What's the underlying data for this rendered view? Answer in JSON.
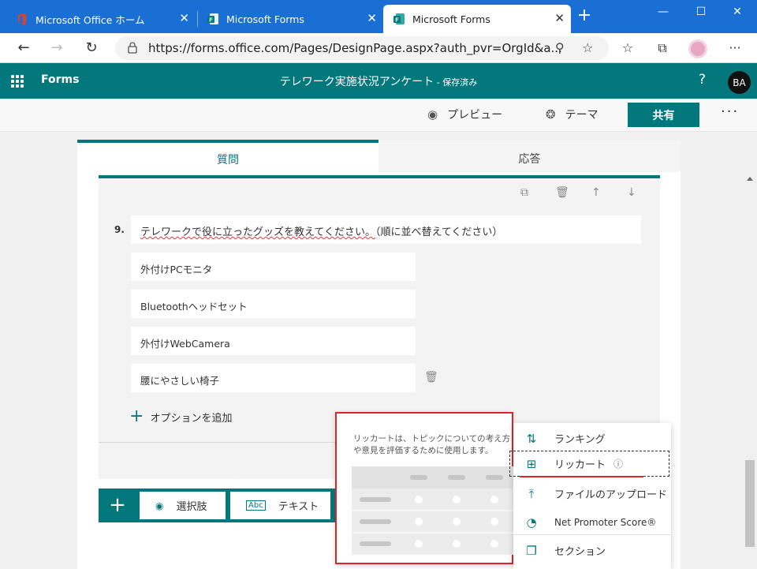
{
  "browser": {
    "tabs": [
      {
        "title": "Microsoft Office ホーム",
        "close": "✕"
      },
      {
        "title": "Microsoft Forms",
        "close": "✕"
      },
      {
        "title": "Microsoft Forms",
        "close": "✕"
      }
    ],
    "new_tab": "+",
    "window_controls": {
      "minimize": "—",
      "maximize": "☐",
      "close": "✕"
    },
    "url": "https://forms.office.com/Pages/DesignPage.aspx?auth_pvr=OrgId&a..."
  },
  "forms_header": {
    "app_name": "Forms",
    "form_title": "テレワーク実施状況アンケート",
    "save_status": " - 保存済み",
    "help": "?",
    "avatar_initials": "BA"
  },
  "command_bar": {
    "preview": "プレビュー",
    "theme": "テーマ",
    "share": "共有",
    "more": "···"
  },
  "tabs": {
    "questions": "質問",
    "responses": "応答"
  },
  "question": {
    "number": "9.",
    "title": "テレワークで役に立ったグッズを教えてください。",
    "title_note": "（順に並べ替えてください）",
    "options": [
      "外付けPCモニタ",
      "Bluetoothヘッドセット",
      "外付けWebCamera",
      "腰にやさしい椅子"
    ],
    "add_option": "オプションを追加"
  },
  "add_bar": {
    "plus": "+",
    "choice": "選択肢",
    "text": "テキスト"
  },
  "tooltip": {
    "line1": "リッカートは、トピックについての考え方",
    "line2": "や意見を評価するために使用します。"
  },
  "menu": {
    "items": [
      {
        "label": "ランキング",
        "icon": "sort-icon"
      },
      {
        "label": "リッカート",
        "icon": "likert-table-icon"
      },
      {
        "label": "ファイルのアップロード",
        "icon": "upload-icon"
      },
      {
        "label": "Net Promoter Score®",
        "icon": "gauge-icon"
      },
      {
        "label": "セクション",
        "icon": "section-icon"
      }
    ],
    "info": "ⓘ"
  },
  "colors": {
    "brand": "#03787c",
    "browser": "#1a6fd4",
    "highlight": "#d9262b"
  }
}
